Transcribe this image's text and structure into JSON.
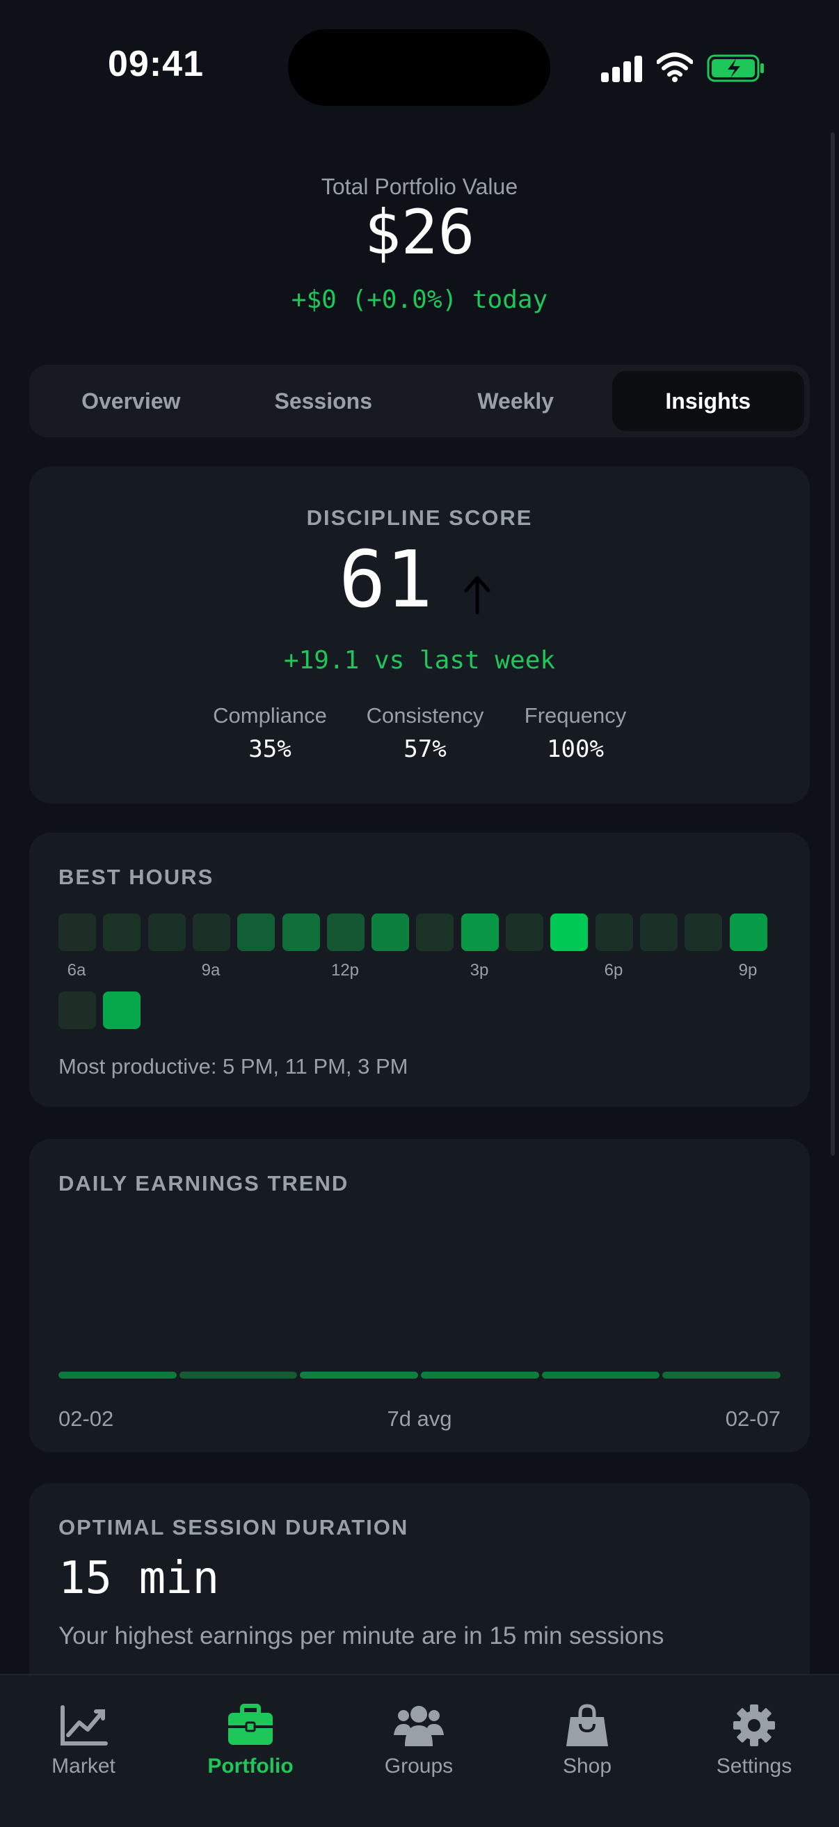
{
  "status_bar": {
    "time": "09:41"
  },
  "header": {
    "label": "Total Portfolio Value",
    "value": "$26",
    "change": "+$0 (+0.0%) today"
  },
  "tabs": [
    {
      "label": "Overview",
      "active": false
    },
    {
      "label": "Sessions",
      "active": false
    },
    {
      "label": "Weekly",
      "active": false
    },
    {
      "label": "Insights",
      "active": true
    }
  ],
  "discipline": {
    "title": "DISCIPLINE SCORE",
    "score": "61",
    "arrow_icon": "arrow-up-icon",
    "change": "+19.1 vs last week",
    "metrics": [
      {
        "label": "Compliance",
        "value": "35%"
      },
      {
        "label": "Consistency",
        "value": "57%"
      },
      {
        "label": "Frequency",
        "value": "100%"
      }
    ]
  },
  "best_hours": {
    "title": "BEST HOURS",
    "intensity": [
      0.05,
      0.08,
      0.06,
      0.07,
      0.35,
      0.45,
      0.3,
      0.55,
      0.08,
      0.7,
      0.07,
      1.0,
      0.07,
      0.07,
      0.06,
      0.72,
      0.05,
      0.8
    ],
    "ticks": [
      "6a",
      "9a",
      "12p",
      "3p",
      "6p",
      "9p"
    ],
    "note": "Most productive: 5 PM, 11 PM, 3 PM"
  },
  "trend": {
    "title": "DAILY EARNINGS TREND",
    "segments": [
      0.7,
      0.3,
      0.8,
      0.75,
      0.7,
      0.5
    ],
    "start_label": "02-02",
    "mid_label": "7d avg",
    "end_label": "02-07"
  },
  "optimal": {
    "title": "OPTIMAL SESSION DURATION",
    "value": "15 min",
    "description": "Your highest earnings per minute are in 15 min sessions"
  },
  "nav": [
    {
      "label": "Market",
      "icon": "chart-line-icon",
      "active": false
    },
    {
      "label": "Portfolio",
      "icon": "briefcase-icon",
      "active": true
    },
    {
      "label": "Groups",
      "icon": "users-icon",
      "active": false
    },
    {
      "label": "Shop",
      "icon": "shopping-bag-icon",
      "active": false
    },
    {
      "label": "Settings",
      "icon": "gear-icon",
      "active": false
    }
  ],
  "colors": {
    "accent": "#1ec75a",
    "background": "#0e1117",
    "card": "#161a21",
    "muted": "#9aa0a8"
  }
}
